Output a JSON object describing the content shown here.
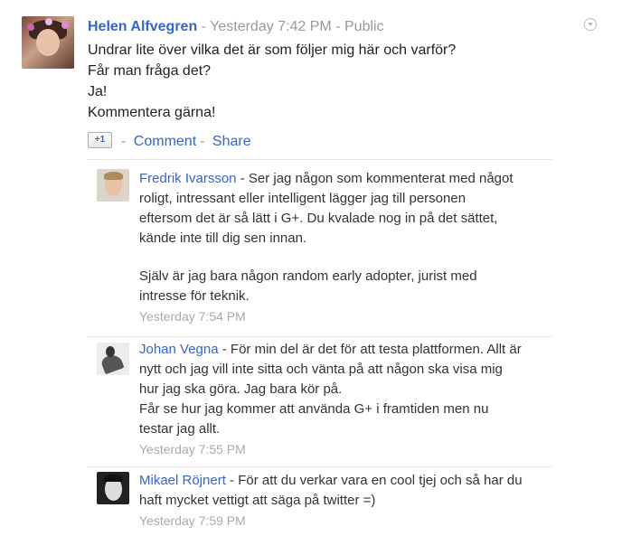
{
  "post": {
    "author": "Helen Alfvegren",
    "separator": "-",
    "time": "Yesterday 7:42 PM",
    "visibility": "Public",
    "lines": [
      "Undrar lite över vilka det är som följer mig här och varför?",
      "Får man fråga det?",
      "Ja!",
      "Kommentera gärna!"
    ],
    "plusone_label": "+1",
    "comment_label": "Comment",
    "share_label": "Share"
  },
  "comments": [
    {
      "author": "Fredrik Ivarsson",
      "lines": [
        "- Ser jag någon som kommenterat med något",
        "roligt, intressant eller intelligent lägger jag till personen",
        "eftersom det är så lätt i G+. Du kvalade nog in på det sättet,",
        "kände inte till dig sen innan.",
        "",
        "Själv är jag bara någon random early adopter, jurist med",
        "intresse för teknik."
      ],
      "time": "Yesterday 7:54 PM"
    },
    {
      "author": "Johan Vegna",
      "lines": [
        "- För min del är det för att testa plattformen. Allt är",
        "nytt och jag vill inte sitta och vänta på att någon ska visa mig",
        "hur jag ska göra. Jag bara kör på.",
        "Får se hur jag kommer att använda G+ i framtiden men nu",
        "testar jag allt."
      ],
      "time": "Yesterday 7:55 PM"
    },
    {
      "author": "Mikael Röjnert",
      "lines": [
        "- För att du verkar vara en cool tjej och så har du",
        "haft mycket vettigt att säga på twitter =)"
      ],
      "time": "Yesterday 7:59 PM"
    }
  ]
}
